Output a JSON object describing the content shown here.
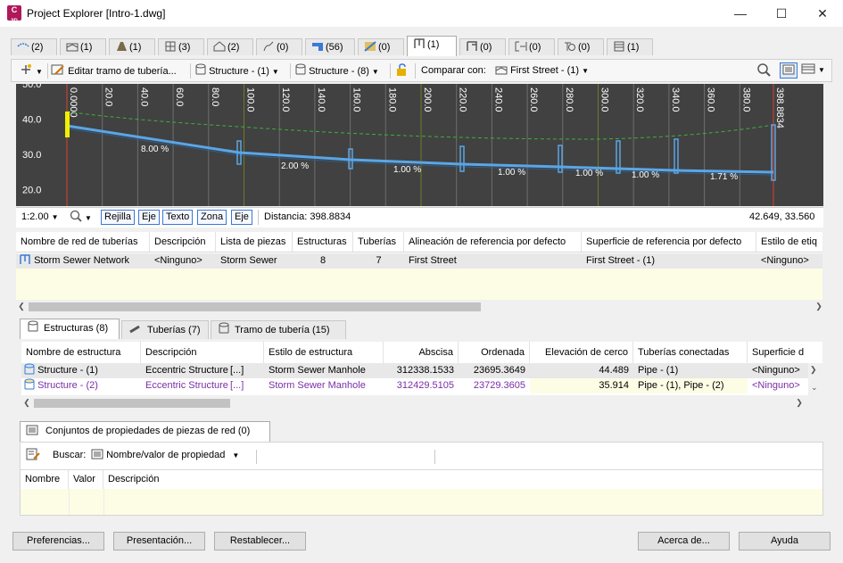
{
  "window": {
    "title": "Project Explorer [Intro-1.dwg]",
    "app_icon": "civil3d-icon",
    "minimize": "—",
    "maximize": "☐",
    "close": "✕"
  },
  "top_tabs": [
    {
      "icon": "alignment-icon",
      "label": "(2)"
    },
    {
      "icon": "profile-icon",
      "label": "(1)"
    },
    {
      "icon": "corridor-icon",
      "label": "(1)"
    },
    {
      "icon": "sample-line-icon",
      "label": "(3)"
    },
    {
      "icon": "surface-icon",
      "label": "(2)"
    },
    {
      "icon": "feature-line-icon",
      "label": "(0)"
    },
    {
      "icon": "point-group-icon",
      "label": "(56)"
    },
    {
      "icon": "parcel-icon",
      "label": "(0)"
    },
    {
      "icon": "pipe-network-icon",
      "label": "(1)"
    },
    {
      "icon": "pressure-network-icon",
      "label": "(0)"
    },
    {
      "icon": "assembly-icon",
      "label": "(0)"
    },
    {
      "icon": "intersection-icon",
      "label": "(0)"
    },
    {
      "icon": "table-icon",
      "label": "(1)"
    }
  ],
  "toolbar": {
    "edit_run_label": "Editar tramo de tubería...",
    "structure_from": "Structure - (1)",
    "structure_to": "Structure - (8)",
    "compare_label": "Comparar con:",
    "compare_value": "First Street - (1)"
  },
  "profile_view": {
    "y_ticks": [
      "50.0",
      "40.0",
      "30.0",
      "20.0"
    ],
    "x_ticks": [
      "0.0000",
      "20.0",
      "40.0",
      "60.0",
      "80.0",
      "100.0",
      "120.0",
      "140.0",
      "160.0",
      "180.0",
      "200.0",
      "220.0",
      "240.0",
      "260.0",
      "280.0",
      "300.0",
      "320.0",
      "340.0",
      "360.0",
      "380.0",
      "398.8834"
    ],
    "slopes": [
      "8.00 %",
      "2.00 %",
      "1.00 %",
      "1.00 %",
      "1.00 %",
      "1.00 %",
      "1.71 %"
    ],
    "colors": {
      "background": "#414141",
      "pipe": "#5aa6e6",
      "ground": "#3fae3f",
      "start_line": "#d9432f",
      "grid": "#6e6e6e",
      "highlight": "#f0f000"
    }
  },
  "profile_bar": {
    "scale": "1:2.00",
    "buttons": [
      "Rejilla",
      "Eje",
      "Texto",
      "Zona",
      "Eje"
    ],
    "distance": "Distancia: 398.8834",
    "coords": "42.649, 33.560"
  },
  "network_table": {
    "headers": [
      "Nombre de red de tuberías",
      "Descripción",
      "Lista de piezas",
      "Estructuras",
      "Tuberías",
      "Alineación de referencia por defecto",
      "Superficie de referencia por defecto",
      "Estilo de etiq"
    ],
    "row": [
      "Storm Sewer Network",
      "<Ninguno>",
      "Storm Sewer",
      "8",
      "7",
      "First Street",
      "First Street - (1)",
      "<Ninguno>"
    ]
  },
  "sub_tabs": [
    "Estructuras (8)",
    "Tuberías (7)",
    "Tramo de tubería (15)"
  ],
  "structures_table": {
    "headers": [
      "Nombre de estructura",
      "Descripción",
      "Estilo de estructura",
      "Abscisa",
      "Ordenada",
      "Elevación de cerco",
      "Tuberías conectadas",
      "Superficie d"
    ],
    "rows": [
      [
        "Structure - (1)",
        "Eccentric Structure",
        "[...]",
        "Storm Sewer Manhole",
        "312338.1533",
        "23695.3649",
        "44.489",
        "Pipe - (1)",
        "<Ninguno>"
      ],
      [
        "Structure - (2)",
        "Eccentric Structure",
        "[...]",
        "Storm Sewer Manhole",
        "312429.5105",
        "23729.3605",
        "35.914",
        "Pipe - (1), Pipe - (2)",
        "<Ninguno>"
      ]
    ],
    "highlight_color": "#7a2ea8"
  },
  "props": {
    "tab": "Conjuntos de propiedades de piezas de red (0)",
    "search_label": "Buscar:",
    "search_value": "Nombre/valor de propiedad",
    "headers": [
      "Nombre",
      "Valor",
      "Descripción"
    ]
  },
  "footer": {
    "prefs": "Preferencias...",
    "presentation": "Presentación...",
    "reset": "Restablecer...",
    "about": "Acerca de...",
    "help": "Ayuda"
  }
}
